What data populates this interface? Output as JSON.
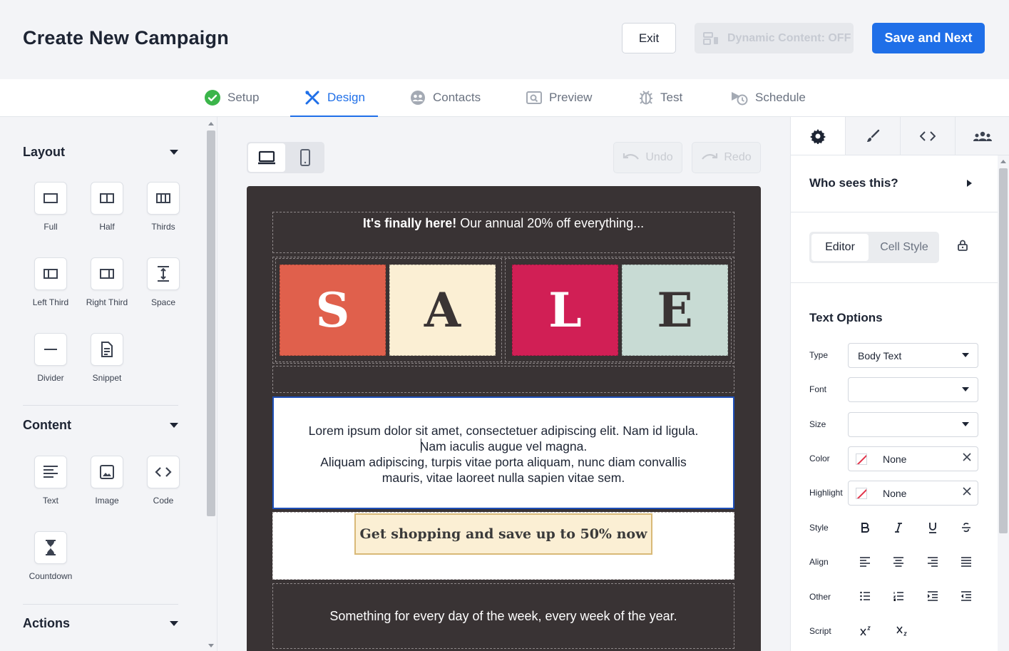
{
  "header": {
    "title": "Create New Campaign",
    "exit_label": "Exit",
    "dynamic_label": "Dynamic Content: OFF",
    "save_label": "Save and Next"
  },
  "tabs": [
    {
      "label": "Setup",
      "icon": "check-circle-icon"
    },
    {
      "label": "Design",
      "icon": "design-tools-icon",
      "active": true
    },
    {
      "label": "Contacts",
      "icon": "contacts-icon"
    },
    {
      "label": "Preview",
      "icon": "preview-icon"
    },
    {
      "label": "Test",
      "icon": "bug-icon"
    },
    {
      "label": "Schedule",
      "icon": "schedule-icon"
    }
  ],
  "sidebar": {
    "layout_title": "Layout",
    "layout_items": [
      {
        "label": "Full",
        "icon": "full-layout-icon"
      },
      {
        "label": "Half",
        "icon": "half-layout-icon"
      },
      {
        "label": "Thirds",
        "icon": "thirds-layout-icon"
      },
      {
        "label": "Left Third",
        "icon": "left-third-icon"
      },
      {
        "label": "Right Third",
        "icon": "right-third-icon"
      },
      {
        "label": "Space",
        "icon": "space-icon"
      },
      {
        "label": "Divider",
        "icon": "divider-icon"
      },
      {
        "label": "Snippet",
        "icon": "snippet-icon"
      }
    ],
    "content_title": "Content",
    "content_items": [
      {
        "label": "Text",
        "icon": "text-icon"
      },
      {
        "label": "Image",
        "icon": "image-icon"
      },
      {
        "label": "Code",
        "icon": "code-icon"
      },
      {
        "label": "Countdown",
        "icon": "hourglass-icon"
      }
    ],
    "actions_title": "Actions"
  },
  "toolbar": {
    "undo_label": "Undo",
    "redo_label": "Redo"
  },
  "email": {
    "top_bold": "It's finally here!",
    "top_rest": " Our annual 20% off everything...",
    "letters": [
      "S",
      "A",
      "L",
      "E"
    ],
    "letter_colors": [
      "#e0604c",
      "#fbefd4",
      "#d11f55",
      "#c8dbd4"
    ],
    "text_lines": [
      "Lorem ipsum dolor sit amet, consectetuer adipiscing elit. Nam id ligula.",
      "Nam iaculis augue vel magna.",
      "Aliquam adipiscing, turpis vitae porta aliquam, nunc diam convallis",
      "mauris, vitae laoreet nulla sapien vitae sem."
    ],
    "cta_label": "Get shopping and save up to 50% now",
    "footer_text": "Something for every day of the week, every week of the year."
  },
  "right": {
    "who_title": "Who sees this?",
    "editor_label": "Editor",
    "cellstyle_label": "Cell Style",
    "text_options_title": "Text Options",
    "labels": {
      "type": "Type",
      "font": "Font",
      "size": "Size",
      "color": "Color",
      "highlight": "Highlight",
      "style": "Style",
      "align": "Align",
      "other": "Other",
      "script": "Script"
    },
    "type_value": "Body Text",
    "font_value": "",
    "size_value": "",
    "color_value": "None",
    "highlight_value": "None"
  },
  "colors": {
    "accent": "#1f6fe8",
    "email_bg": "#393334",
    "success": "#3bb54a"
  }
}
